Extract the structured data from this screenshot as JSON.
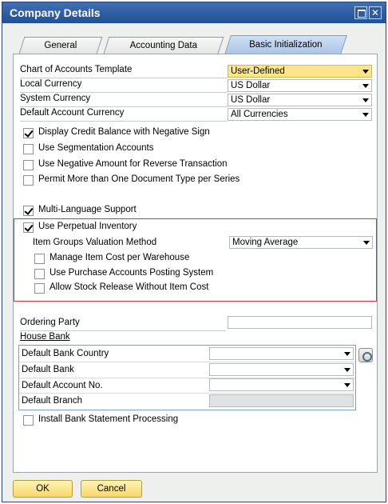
{
  "window": {
    "title": "Company Details"
  },
  "tabs": [
    {
      "label": "General"
    },
    {
      "label": "Accounting Data"
    },
    {
      "label": "Basic Initialization"
    }
  ],
  "fields": {
    "chart_of_accounts": {
      "label": "Chart of Accounts Template",
      "value": "User-Defined"
    },
    "local_currency": {
      "label": "Local Currency",
      "value": "US Dollar"
    },
    "system_currency": {
      "label": "System Currency",
      "value": "US Dollar"
    },
    "default_account_currency": {
      "label": "Default Account Currency",
      "value": "All Currencies"
    }
  },
  "checkboxes": {
    "display_credit_balance": {
      "label": "Display Credit Balance with Negative Sign",
      "checked": true
    },
    "use_segmentation": {
      "label": "Use Segmentation Accounts",
      "checked": false
    },
    "use_negative_amount": {
      "label": "Use Negative Amount for Reverse Transaction",
      "checked": false
    },
    "permit_more_doc_types": {
      "label": "Permit More than One Document Type per Series",
      "checked": false
    },
    "multi_language": {
      "label": "Multi-Language Support",
      "checked": true
    },
    "perpetual_inventory": {
      "label": "Use Perpetual Inventory",
      "checked": true
    },
    "manage_item_cost": {
      "label": "Manage Item Cost per Warehouse",
      "checked": false
    },
    "use_purchase_accounts": {
      "label": "Use Purchase Accounts Posting System",
      "checked": false
    },
    "allow_stock_release": {
      "label": "Allow Stock Release Without Item Cost",
      "checked": false
    },
    "install_bank_statement": {
      "label": "Install Bank Statement Processing",
      "checked": false
    }
  },
  "valuation": {
    "label": "Item Groups Valuation Method",
    "value": "Moving Average"
  },
  "ordering_party": {
    "label": "Ordering Party",
    "value": ""
  },
  "house_bank": {
    "title": "House Bank",
    "rows": [
      {
        "label": "Default Bank Country",
        "value": ""
      },
      {
        "label": "Default Bank",
        "value": ""
      },
      {
        "label": "Default Account No.",
        "value": ""
      },
      {
        "label": "Default Branch",
        "value": ""
      }
    ]
  },
  "buttons": {
    "ok": "OK",
    "cancel": "Cancel"
  },
  "colors": {
    "titlebar": "#2a5599",
    "highlight_box": "#e03030",
    "button": "#f7d865",
    "dropdown_highlight": "#fde58a"
  }
}
